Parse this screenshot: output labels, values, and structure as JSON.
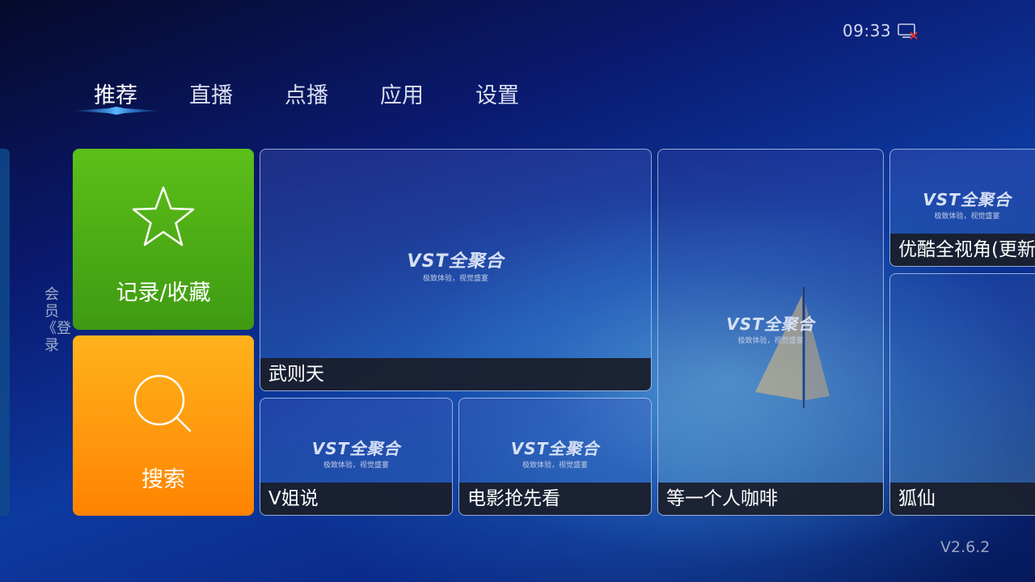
{
  "status": {
    "time": "09:33",
    "network_icon": "network-disconnected-icon"
  },
  "nav": {
    "tabs": [
      {
        "label": "推荐",
        "active": true
      },
      {
        "label": "直播"
      },
      {
        "label": "点播"
      },
      {
        "label": "应用"
      },
      {
        "label": "设置"
      }
    ]
  },
  "sidebar": {
    "login_label": "会员《登录"
  },
  "functions": {
    "favorites": {
      "label": "记录/收藏",
      "icon": "star-icon",
      "color": "#4caf17"
    },
    "search": {
      "label": "搜索",
      "icon": "search-icon",
      "color": "#ff9800"
    }
  },
  "logo": {
    "main": "VST全聚合",
    "sub": "极致体验，视觉盛宴"
  },
  "tiles": {
    "wuzetian": "武则天",
    "vjieshuo": "V姐说",
    "dianying": "电影抢先看",
    "dengyigeren": "等一个人咖啡",
    "youku": "优酷全视角(更新",
    "huxian": "狐仙"
  },
  "version": "V2.6.2"
}
